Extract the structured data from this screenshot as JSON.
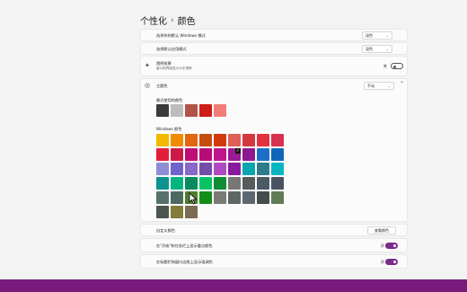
{
  "breadcrumb": {
    "parent": "个性化",
    "separator": "›",
    "current": "颜色"
  },
  "rows": {
    "windows_mode": {
      "label": "选择你的默认 Windows 模式",
      "value": "深色"
    },
    "app_mode": {
      "label": "选择默认应用模式",
      "value": "深色"
    },
    "transparency": {
      "title": "透明效果",
      "subtitle": "窗口和界面显示为半透明",
      "state": "关",
      "on": false
    },
    "accent": {
      "title": "主题色",
      "value": "手动"
    }
  },
  "recent_colors": {
    "label": "最近使用的颜色",
    "colors": [
      "#3a3a3a",
      "#bdbdbd",
      "#b0544a",
      "#cc1e16",
      "#f27d78"
    ]
  },
  "windows_colors": {
    "label": "Windows 颜色",
    "selected": "#9a1a96",
    "rows": [
      [
        "#f2b900",
        "#f08c00",
        "#e2660f",
        "#c54e0e",
        "#d13a0c",
        "#de5f58",
        "#d2383f",
        "#e33140",
        "#d8304e"
      ],
      [
        "#e21e3c",
        "#cc1b49",
        "#bd0f73",
        "#b70c78",
        "#be168c",
        "#9a1a96",
        "#8c198f",
        "#1b6fc7",
        "#1067b8"
      ],
      [
        "#8e8dd5",
        "#6f64cc",
        "#8968c7",
        "#744da9",
        "#b04ac2",
        "#8a18a0",
        "#07a5ad",
        "#2d7b8c",
        "#05b5c0"
      ],
      [
        "#0c928f",
        "#04b47f",
        "#078a5d",
        "#07c463",
        "#0f8c36",
        "#797775",
        "#575b5b",
        "#4c5a66",
        "#4a5362"
      ],
      [
        "#56716b",
        "#4c6a60",
        "#4e7d2c",
        "#138e18",
        "#7a7a76",
        "#5e6764",
        "#5c6870",
        "#444c4d",
        "#5f7c56"
      ],
      [
        "#4b5651",
        "#817c38",
        "#7b6b52"
      ]
    ]
  },
  "custom_colors": {
    "label": "自定义颜色",
    "button": "查看颜色"
  },
  "start_taskbar": {
    "label": "在\"开始\"和任务栏上显示重点颜色",
    "state": "开",
    "on": true
  },
  "title_bars": {
    "label": "在标题栏和窗口边框上显示强调色",
    "state": "开",
    "on": true
  },
  "taskbar_color": "#7a1a7d"
}
